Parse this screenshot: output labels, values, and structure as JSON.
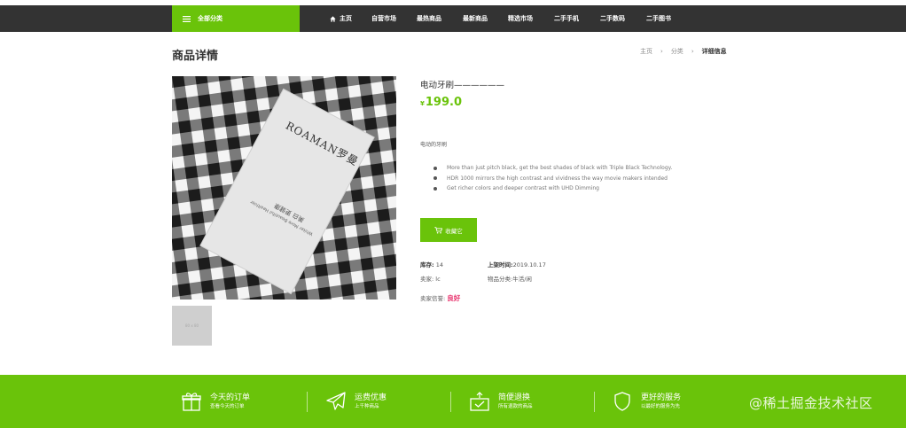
{
  "nav": {
    "category_label": "全部分类",
    "items": [
      "主页",
      "自营市场",
      "最热商品",
      "最新商品",
      "精选市场",
      "二手手机",
      "二手数码",
      "二手图书"
    ]
  },
  "header": {
    "title": "商品详情",
    "breadcrumb": [
      "主页",
      "分类",
      "详细信息"
    ]
  },
  "product": {
    "image_box_text": "ROAMAN罗曼",
    "image_subtext": "Whiter More Beautiful Healthier",
    "image_cn_text": "美白 更健康",
    "thumb_text": "80 x 80",
    "name": "电动牙刷——————",
    "currency": "¥",
    "price": "199.0",
    "description": "电动的牙刷",
    "features": [
      "More than just pitch black, get the best shades of black with Triple Black Technology.",
      "HDR 1000 mirrors the high contrast and vividness the way movie makers intended",
      "Get richer colors and deeper contrast with UHD Dimming"
    ],
    "cart_label": "收藏它"
  },
  "meta": {
    "stock_label": "库存:",
    "stock_value": "14",
    "date_label": "上架时间:",
    "date_value": "2019.10.17",
    "seller_label": "卖家:",
    "seller_value": "lc",
    "category_label": "物品分类:",
    "category_value": "牛活/闲",
    "credit_label": "卖家信誉:",
    "credit_value": "良好"
  },
  "footer": {
    "items": [
      {
        "title": "今天的订单",
        "sub": "查看今天的订单"
      },
      {
        "title": "运费优惠",
        "sub": "上千种商品"
      },
      {
        "title": "简便退换",
        "sub": "所有退款的商品"
      },
      {
        "title": "更好的服务",
        "sub": "以最好的服务为先"
      }
    ]
  },
  "watermark": "@稀土掘金技术社区",
  "colors": {
    "accent": "#6ac30a",
    "nav_bg": "#333333",
    "good": "#e8306b"
  }
}
